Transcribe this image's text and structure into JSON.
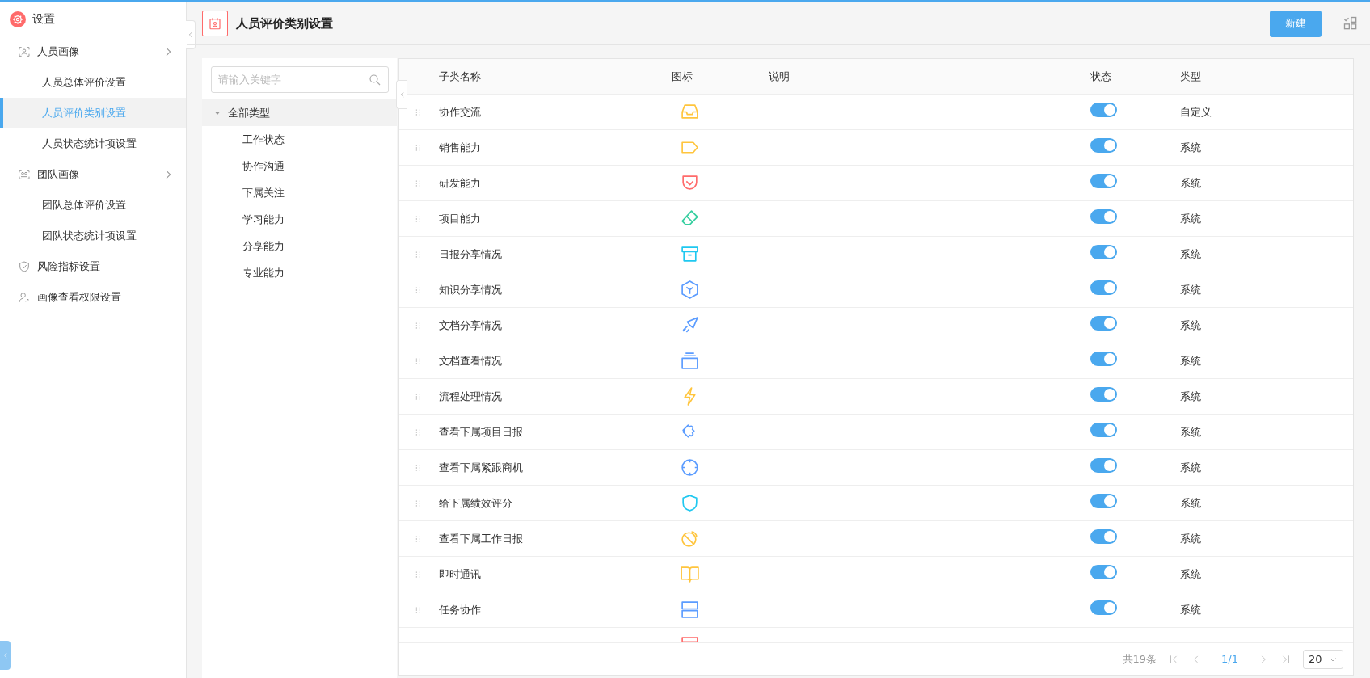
{
  "sidebar": {
    "title": "设置",
    "items": [
      {
        "label": "人员画像",
        "kind": "person-frame",
        "expanded": false,
        "children": [
          {
            "label": "人员总体评价设置",
            "selected": false
          },
          {
            "label": "人员评价类别设置",
            "selected": true
          },
          {
            "label": "人员状态统计项设置",
            "selected": false
          }
        ]
      },
      {
        "label": "团队画像",
        "kind": "team-frame",
        "expanded": false,
        "children": [
          {
            "label": "团队总体评价设置",
            "selected": false
          },
          {
            "label": "团队状态统计项设置",
            "selected": false
          }
        ]
      },
      {
        "label": "风险指标设置",
        "kind": "shield-check"
      },
      {
        "label": "画像查看权限设置",
        "kind": "person-key"
      }
    ]
  },
  "header": {
    "title": "人员评价类别设置",
    "new_button": "新建"
  },
  "tree": {
    "search": {
      "placeholder": "请输入关键字"
    },
    "root": {
      "label": "全部类型",
      "expanded": true,
      "selected": true,
      "children": [
        {
          "label": "工作状态",
          "selected": false
        },
        {
          "label": "协作沟通",
          "selected": false
        },
        {
          "label": "下属关注",
          "selected": false
        },
        {
          "label": "学习能力",
          "selected": false
        },
        {
          "label": "分享能力",
          "selected": false
        },
        {
          "label": "专业能力",
          "selected": false
        }
      ]
    }
  },
  "table": {
    "columns": [
      "子类名称",
      "图标",
      "说明",
      "状态",
      "类型"
    ],
    "rows": [
      {
        "name": "协作交流",
        "kind": "inbox",
        "color": "#ffc53d",
        "on": true,
        "type": "自定义"
      },
      {
        "name": "销售能力",
        "kind": "tag",
        "color": "#ffc53d",
        "on": true,
        "type": "系统"
      },
      {
        "name": "研发能力",
        "kind": "pocket",
        "color": "#ff6b6b",
        "on": true,
        "type": "系统"
      },
      {
        "name": "项目能力",
        "kind": "eraser",
        "color": "#36cfa0",
        "on": true,
        "type": "系统"
      },
      {
        "name": "日报分享情况",
        "kind": "archive",
        "color": "#1fc8f0",
        "on": true,
        "type": "系统"
      },
      {
        "name": "知识分享情况",
        "kind": "hexagon",
        "color": "#5b9cff",
        "on": true,
        "type": "系统"
      },
      {
        "name": "文档分享情况",
        "kind": "send",
        "color": "#5b9cff",
        "on": true,
        "type": "系统"
      },
      {
        "name": "文档查看情况",
        "kind": "stack",
        "color": "#5b9cff",
        "on": true,
        "type": "系统"
      },
      {
        "name": "流程处理情况",
        "kind": "bolt",
        "color": "#ffc53d",
        "on": true,
        "type": "系统"
      },
      {
        "name": "查看下属项目日报",
        "kind": "puzzle",
        "color": "#5b9cff",
        "on": true,
        "type": "系统"
      },
      {
        "name": "查看下属紧跟商机",
        "kind": "crosshair",
        "color": "#5b9cff",
        "on": true,
        "type": "系统"
      },
      {
        "name": "给下属绩效评分",
        "kind": "shield",
        "color": "#1fc8f0",
        "on": true,
        "type": "系统"
      },
      {
        "name": "查看下属工作日报",
        "kind": "dish",
        "color": "#ffc53d",
        "on": true,
        "type": "系统"
      },
      {
        "name": "即时通讯",
        "kind": "book",
        "color": "#ffc53d",
        "on": true,
        "type": "系统"
      },
      {
        "name": "任务协作",
        "kind": "rows",
        "color": "#5b9cff",
        "on": true,
        "type": "系统"
      },
      {
        "kind": "box",
        "color": "#ff6b6b"
      }
    ]
  },
  "pagination": {
    "total": "共19条",
    "page": "1/1",
    "page_size": "20"
  }
}
